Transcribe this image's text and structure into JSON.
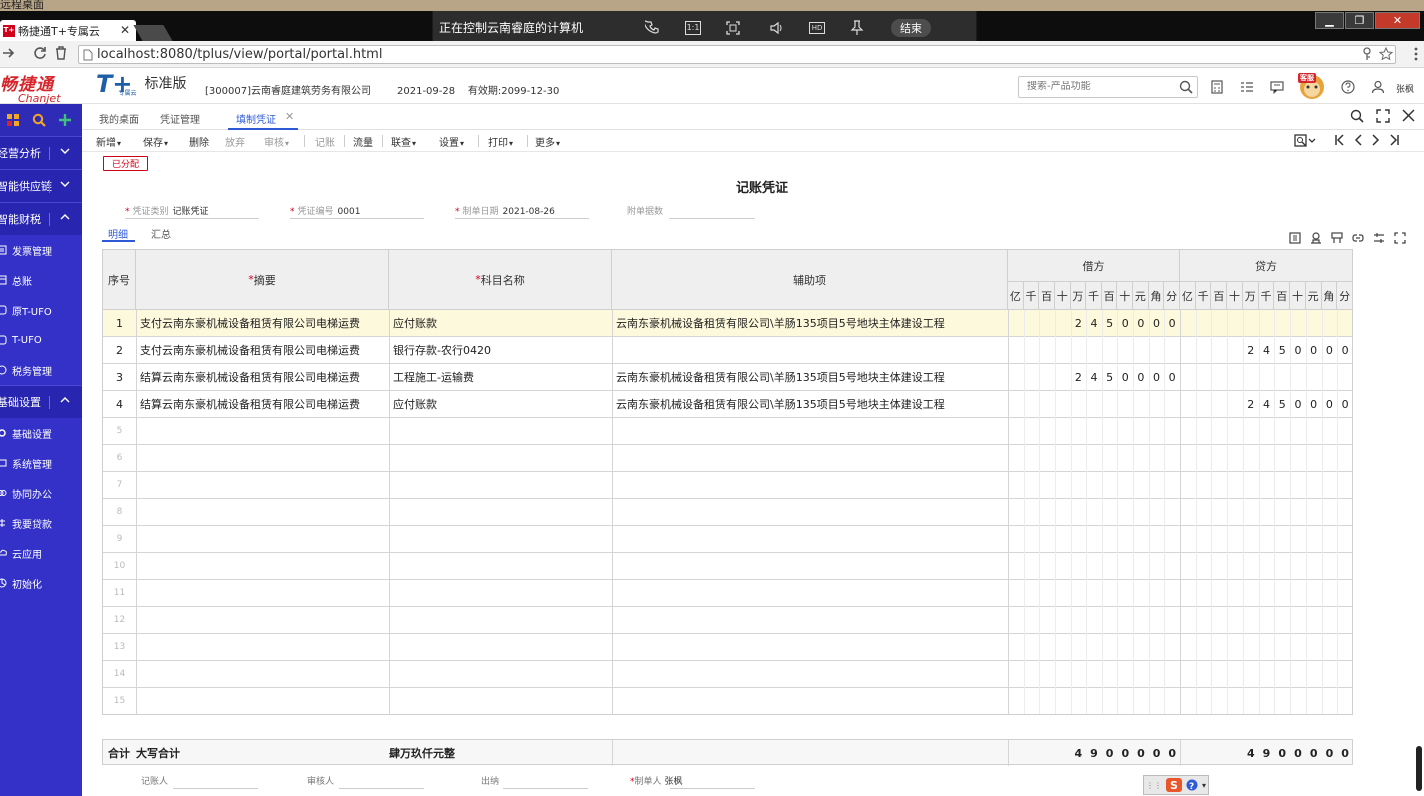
{
  "window": {
    "title": "远程桌面"
  },
  "browser": {
    "tab_title": "畅捷通T+专属云",
    "favicon_text": "T+",
    "url": "localhost:8080/tplus/view/portal/portal.html"
  },
  "remote_bar": {
    "text": "正在控制云南睿庭的计算机",
    "end_label": "结束",
    "ratio_label": "1:1",
    "hd_label": "HD"
  },
  "header": {
    "brand_cn": "畅捷通",
    "brand_en": "Chanjet",
    "product_logo": "T+",
    "product_sub": "专属云",
    "edition": "标准版",
    "company": "[300007]云南睿庭建筑劳务有限公司",
    "login_date": "2021-09-28",
    "expiry": "有效期:2099-12-30",
    "search_placeholder": "搜索-产品功能",
    "mascot_label": "客服",
    "user": "张枫"
  },
  "sidebar": {
    "sections": [
      {
        "label": "经营分析"
      },
      {
        "label": "智能供应链"
      },
      {
        "label": "智能财税"
      }
    ],
    "tax_items": [
      "发票管理",
      "总账",
      "原T-UFO",
      "T-UFO",
      "税务管理"
    ],
    "basic_section": "基础设置",
    "basic_items": [
      "基础设置",
      "系统管理",
      "协同办公",
      "我要贷款",
      "云应用",
      "初始化"
    ]
  },
  "module_tabs": [
    "我的桌面",
    "凭证管理",
    "填制凭证"
  ],
  "toolbar": {
    "items": [
      "新增",
      "保存",
      "删除",
      "放弃",
      "审核",
      "记账",
      "流量",
      "联查",
      "设置",
      "打印",
      "更多"
    ]
  },
  "voucher": {
    "status_stamp": "已分配",
    "title": "记账凭证",
    "type_label": "凭证类别",
    "type_value": "记账凭证",
    "no_label": "凭证编号",
    "no_value": "0001",
    "date_label": "制单日期",
    "date_value": "2021-08-26",
    "attach_label": "附单据数",
    "subtabs": [
      "明细",
      "汇总"
    ]
  },
  "table": {
    "headers": {
      "seq": "序号",
      "summary": "摘要",
      "account": "科目名称",
      "aux": "辅助项",
      "debit": "借方",
      "credit": "贷方",
      "digits": [
        "亿",
        "千",
        "百",
        "十",
        "万",
        "千",
        "百",
        "十",
        "元",
        "角",
        "分"
      ]
    },
    "rows": [
      {
        "seq": "1",
        "summary": "支付云南东豪机械设备租赁有限公司电梯运费",
        "account": "应付账款",
        "aux": "云南东豪机械设备租赁有限公司\\羊肠135项目5号地块主体建设工程",
        "debit": "2450000",
        "credit": ""
      },
      {
        "seq": "2",
        "summary": "支付云南东豪机械设备租赁有限公司电梯运费",
        "account": "银行存款-农行0420",
        "aux": "",
        "debit": "",
        "credit": "2450000"
      },
      {
        "seq": "3",
        "summary": "结算云南东豪机械设备租赁有限公司电梯运费",
        "account": "工程施工-运输费",
        "aux": "云南东豪机械设备租赁有限公司\\羊肠135项目5号地块主体建设工程",
        "debit": "2450000",
        "credit": ""
      },
      {
        "seq": "4",
        "summary": "结算云南东豪机械设备租赁有限公司电梯运费",
        "account": "应付账款",
        "aux": "云南东豪机械设备租赁有限公司\\羊肠135项目5号地块主体建设工程",
        "debit": "",
        "credit": "2450000"
      }
    ],
    "empty_rows": [
      "5",
      "6",
      "7",
      "8",
      "9",
      "10",
      "11",
      "12",
      "13",
      "14",
      "15"
    ]
  },
  "total": {
    "label": "合计",
    "caps_label": "大写合计",
    "caps_value": "肆万玖仟元整",
    "debit": "4900000",
    "credit": "4900000"
  },
  "footer": {
    "bookkeeper": "记账人",
    "auditor": "审核人",
    "cashier": "出纳",
    "maker_label": "制单人",
    "maker": "张枫"
  },
  "colors": {
    "sidebar": "#3331c7",
    "accent": "#2e5ad8",
    "required": "#d0021b",
    "selected_row": "#fdf9dc"
  }
}
